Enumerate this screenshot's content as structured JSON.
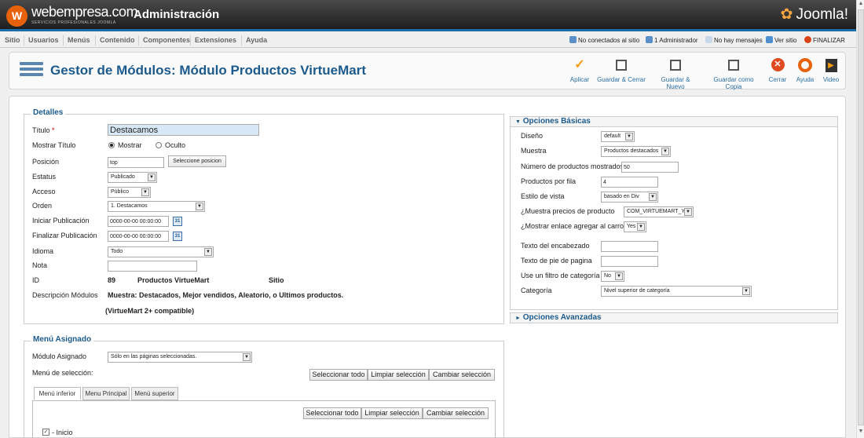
{
  "header": {
    "logo_letter": "W",
    "brand": "webempresa.com",
    "brand_sub": "SERVICIOS PROFESIONALES JOOMLA",
    "title": "Administración",
    "joomla": "Joomla!"
  },
  "menu": [
    "Sitio",
    "Usuarios",
    "Menús",
    "Contenido",
    "Componentes",
    "Extensiones",
    "Ayuda"
  ],
  "status": {
    "not_connected": "No conectados al sitio",
    "admins": "1 Administrador",
    "messages": "No hay mensajes",
    "view_site": "Ver sitio",
    "logout": "FINALIZAR"
  },
  "toolbar": {
    "page_title": "Gestor de Módulos: Módulo Productos VirtueMart",
    "buttons": [
      "Aplicar",
      "Guardar & Cerrar",
      "Guardar & Nuevo",
      "Guardar como Copia",
      "Cerrar",
      "Ayuda",
      "Video"
    ]
  },
  "details": {
    "legend": "Detalles",
    "title_label": "Título",
    "required_mark": "*",
    "title_value": "Destacamos",
    "show_title_label": "Mostrar Título",
    "show_option": "Mostrar",
    "hide_option": "Oculto",
    "position_label": "Posición",
    "position_value": "top",
    "position_button": "Seleccione posicion",
    "status_label": "Estatus",
    "status_value": "Publicado",
    "access_label": "Acceso",
    "access_value": "Público",
    "order_label": "Orden",
    "order_value": "1. Destacamos",
    "start_label": "Iniciar Publicación",
    "start_value": "0000-00-00 00:00:00",
    "end_label": "Finalizar Publicación",
    "end_value": "0000-00-00 00:00:00",
    "cal_label": "31",
    "language_label": "Idioma",
    "language_value": "Todo",
    "note_label": "Nota",
    "note_value": "",
    "id_label": "ID",
    "id_value": "89",
    "module_name": "Productos VirtueMart",
    "module_site": "Sitio",
    "description_label": "Descripción Módulos",
    "description_value": "Muestra: Destacados, Mejor vendidos, Aleatorio, o Ultimos productos.",
    "compat": "(VirtueMart 2+ compatible)"
  },
  "menu_assign": {
    "legend": "Menú Asignado",
    "assign_label": "Módulo Asignado",
    "assign_value": "Sólo en las páginas seleccionadas.",
    "selection_label": "Menú de selección:",
    "select_all": "Seleccionar todo",
    "clear_selection": "Limpiar selección",
    "toggle_selection": "Cambiar selección",
    "tabs": [
      "Menú inferior",
      "Menu Principal",
      "Menú superior"
    ],
    "first_item": "- Inicio"
  },
  "basic_options": {
    "header": "Opciones Básicas",
    "rows": [
      {
        "label": "Diseño",
        "value": "default"
      },
      {
        "label": "Muestra",
        "value": "Productos destacados"
      },
      {
        "label": "Número de productos mostrados",
        "value": "50"
      },
      {
        "label": "Productos por fila",
        "value": "4"
      },
      {
        "label": "Estilo de vista",
        "value": "basado en Div"
      },
      {
        "label": "¿Muestra precios de producto",
        "value": "COM_VIRTUEMART_YES"
      },
      {
        "label": "¿Mostrar enlace agregar al carro?",
        "value": "Yes"
      },
      {
        "label": "Texto del encabezado",
        "value": ""
      },
      {
        "label": "Texto de pie de pagina",
        "value": ""
      },
      {
        "label": "Use un filtro de categoría",
        "value": "No"
      },
      {
        "label": "Categoría",
        "value": "Nivel superior de categoría"
      }
    ]
  },
  "advanced_options": {
    "header": "Opciones Avanzadas"
  },
  "colors": {
    "accent": "#1c5a8c",
    "topbar": "#2a2a2a",
    "brand_orange": "#e8620c"
  },
  "icons": {
    "arrow_down": "▼",
    "arrow_right": "►",
    "check": "✓",
    "scroll_up": "▲",
    "scroll_down": "▼"
  }
}
